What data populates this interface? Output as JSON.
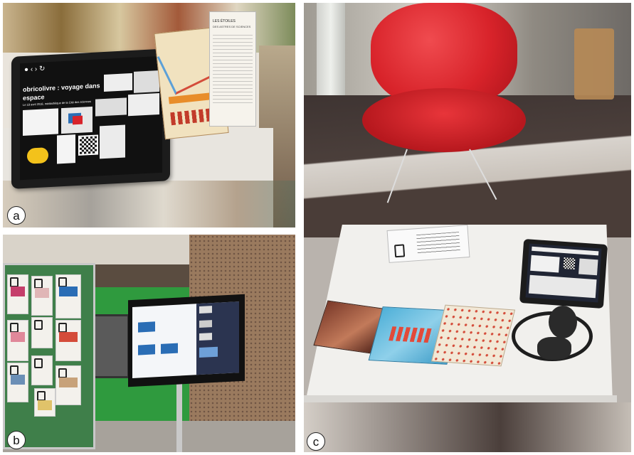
{
  "panels": [
    {
      "id": "a",
      "label": "a"
    },
    {
      "id": "b",
      "label": "b"
    },
    {
      "id": "c",
      "label": "c"
    }
  ],
  "tablet_screen": {
    "title": "obricolivre : voyage dans",
    "title_line2": "espace",
    "subtitle": "Le 18 avril 2018, médiathèque de la Cité des sciences"
  },
  "book_cover": {
    "title": "LES ÉTOILES",
    "subtitle": "DES ASTRES DE SCIENCES"
  },
  "colors": {
    "chair": "#d8232a",
    "tablet_frame": "#1c1c1c",
    "wall_green": "#2f9a3e",
    "accent_yellow": "#f3c21b"
  }
}
